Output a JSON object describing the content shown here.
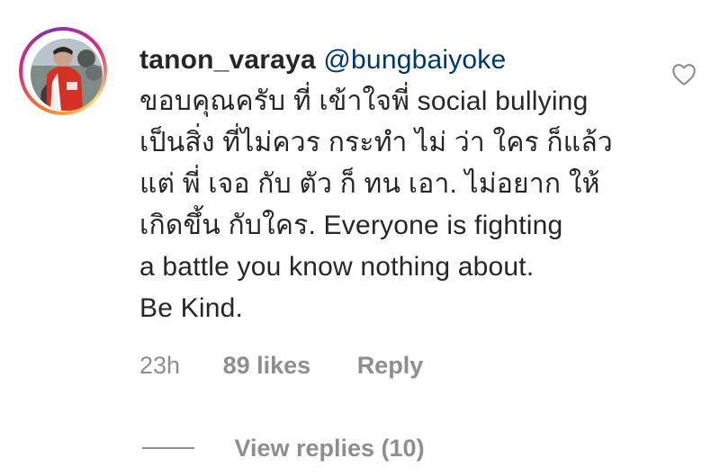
{
  "comment": {
    "username": "tanon_varaya",
    "mention": "@bungbaiyoke",
    "lines": [
      "ขอบคุณครับ ที่ เข้าใจพี่ social bullying",
      "เป็นสิ่ง ที่ไม่ควร กระทำ ไม่ ว่า ใคร ก็แล้ว",
      "แต่ พี่ เจอ กับ ตัว ก็ ทน เอา. ไม่อยาก ให้",
      "เกิดขึ้น กับใคร. Everyone is fighting",
      "a battle you know nothing about.",
      "Be Kind."
    ],
    "time": "23h",
    "likes": "89 likes",
    "reply_label": "Reply",
    "view_replies": "View replies (10)",
    "icons": {
      "avatar": "profile-photo",
      "like": "heart-outline-icon"
    },
    "colors": {
      "text": "#262626",
      "mention": "#00376b",
      "secondary": "#8e8e8e"
    }
  }
}
